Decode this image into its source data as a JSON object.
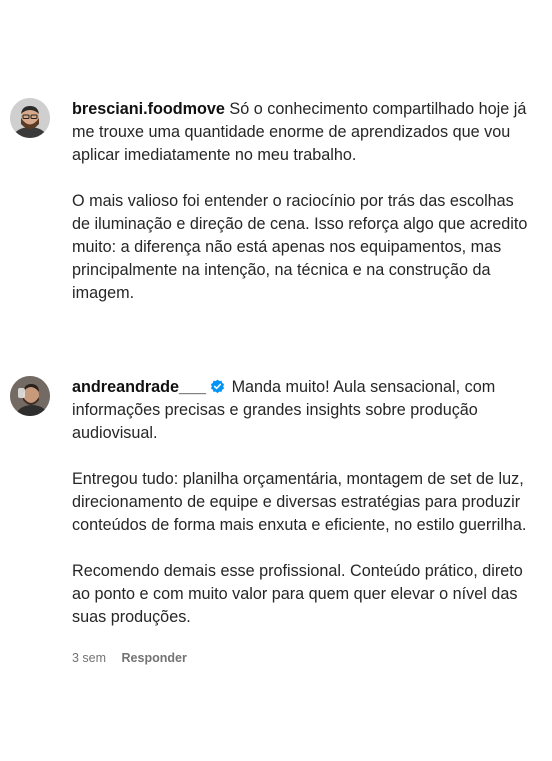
{
  "comments": [
    {
      "username": "bresciani.foodmove",
      "verified": false,
      "first_line": "Só o conhecimento compartilhado hoje já me trouxe uma quantidade enorme de aprendizados que vou aplicar imediatamente no meu trabalho.",
      "paragraphs": [
        "O mais valioso foi entender o raciocínio por trás das escolhas de iluminação e direção de cena. Isso reforça algo que acredito muito: a diferença não está apenas nos equipamentos, mas principalmente na intenção, na técnica e na construção da imagem."
      ]
    },
    {
      "username": "andreandrade___",
      "verified": true,
      "first_line": "Manda muito! Aula sensacional, com informações precisas e grandes insights sobre produção audiovisual.",
      "paragraphs": [
        "Entregou tudo: planilha orçamentária, montagem de set de luz, direcionamento de equipe e diversas estratégias para produzir conteúdos de forma mais enxuta e eficiente, no estilo guerrilha.",
        "Recomendo demais esse profissional. Conteúdo prático, direto ao ponto e com muito valor para quem quer elevar o nível das suas produções."
      ],
      "time": "3 sem",
      "reply_label": "Responder"
    }
  ],
  "colors": {
    "text": "#262626",
    "meta": "#737373",
    "verified": "#0095f6"
  },
  "icons": [
    "avatar-bresciani",
    "avatar-andreandrade",
    "verified-badge-icon"
  ]
}
